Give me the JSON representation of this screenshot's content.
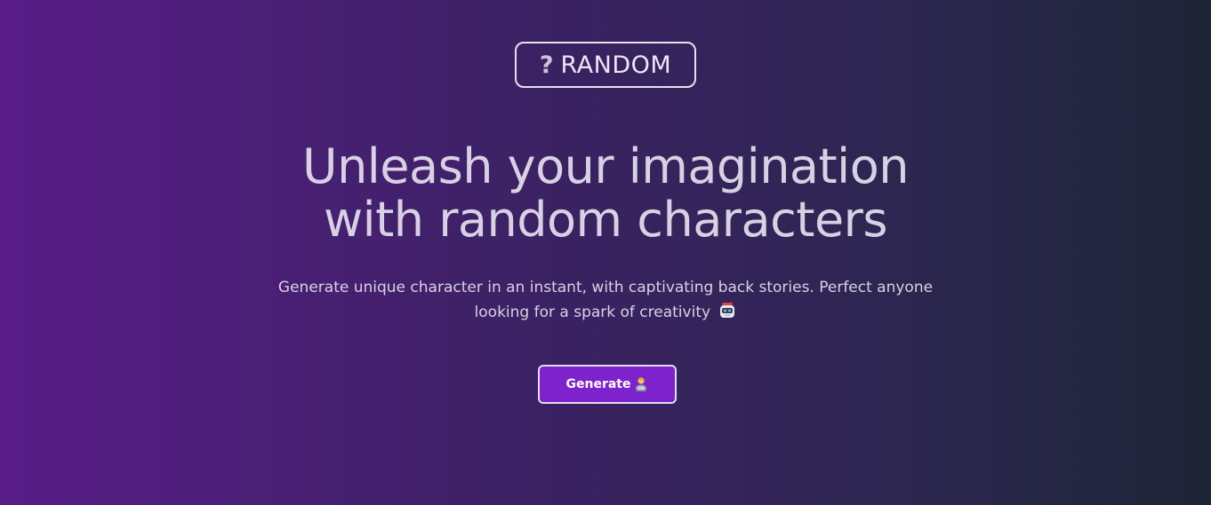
{
  "logo": {
    "icon": "question-mark-icon",
    "icon_glyph": "?",
    "text": "RANDOM"
  },
  "hero": {
    "headline_line1": "Unleash your imagination",
    "headline_line2": "with random characters",
    "subtitle_line1": "Generate unique character in an instant, with captivating back stories. Perfect anyone",
    "subtitle_line2": "looking for a spark of creativity",
    "subtitle_icon": "robot-icon"
  },
  "actions": {
    "generate_label": "Generate",
    "generate_icon": "technologist-icon"
  },
  "colors": {
    "gradient_start": "#581c87",
    "gradient_end": "#1e2536",
    "button_bg": "#7e22ce",
    "button_border": "#e3dcef",
    "text": "#d7d1e3"
  }
}
